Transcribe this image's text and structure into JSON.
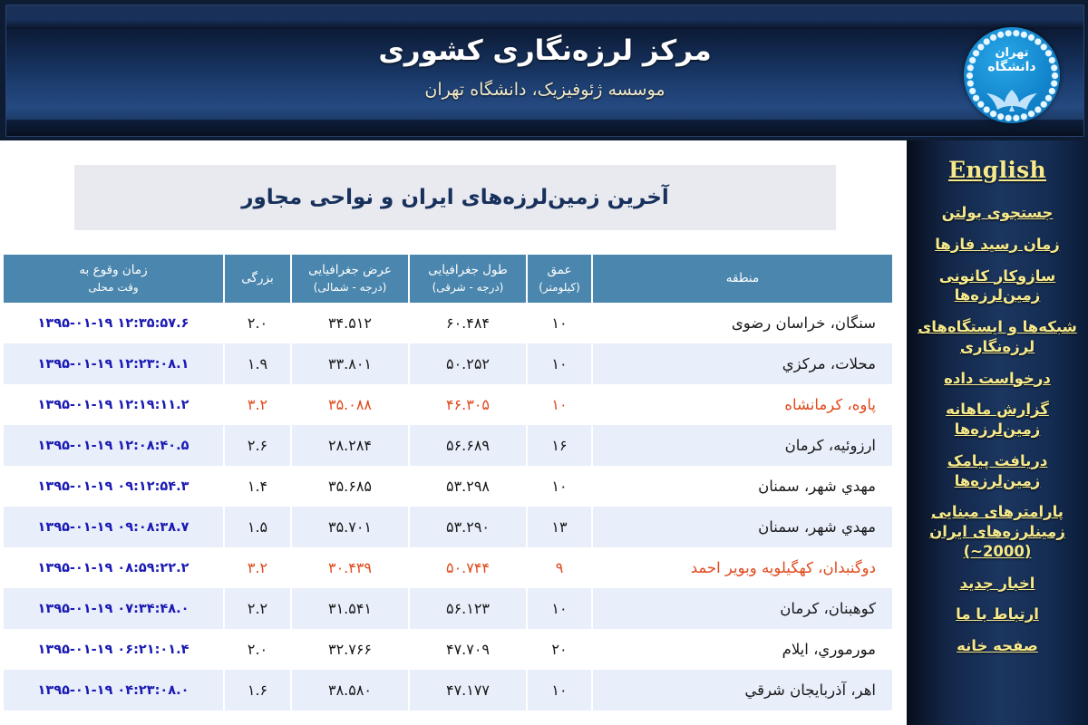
{
  "header": {
    "title": "مرکز لرزه‌نگاری کشوری",
    "subtitle": "موسسه ژئوفیزیک، دانشگاه تهران",
    "logo_line1": "تهران",
    "logo_line2": "دانشگاه",
    "logo_name": "university-of-tehran-logo"
  },
  "sidebar": {
    "english_label": "English",
    "items": [
      {
        "label": "جستجوی بولتن"
      },
      {
        "label": "زمان رسید فازها"
      },
      {
        "label": "سازوکار کانونی زمین‌لرزه‌ها"
      },
      {
        "label": "شبکه‌ها و ایستگاه‌های لرزه‌نگاری"
      },
      {
        "label": "درخواست داده"
      },
      {
        "label": "گزارش ماهانه زمین‌لرزه‌ها"
      },
      {
        "label": "دریافت پیامک زمین‌لرزه‌ها"
      },
      {
        "label": "پارامترهای مبنایی زمینلرزه‌های ایران (2000~)"
      },
      {
        "label": "اخبار جدید"
      },
      {
        "label": "ارتباط با ما"
      },
      {
        "label": "صفحه خانه"
      }
    ]
  },
  "main": {
    "page_title": "آخرین زمین‌لرزه‌های ایران و نواحی مجاور",
    "table": {
      "columns": [
        {
          "key": "region",
          "label": "منطقه",
          "sub": ""
        },
        {
          "key": "depth",
          "label": "عمق",
          "sub": "(کیلومتر)"
        },
        {
          "key": "longitude",
          "label": "طول جغرافیایی",
          "sub": "(درجه - شرقی)"
        },
        {
          "key": "latitude",
          "label": "عرض جغرافیایی",
          "sub": "(درجه - شمالی)"
        },
        {
          "key": "magnitude",
          "label": "بزرگی",
          "sub": ""
        },
        {
          "key": "time",
          "label": "زمان وقوع به",
          "sub": "وقت محلی"
        }
      ],
      "rows": [
        {
          "region": "سنگان، خراسان رضوی",
          "depth": "۱۰",
          "longitude": "۶۰.۴۸۴",
          "latitude": "۳۴.۵۱۲",
          "magnitude": "۲.۰",
          "time": "۱۳۹۵-۰۱-۱۹ ۱۲:۳۵:۵۷.۶",
          "alert": false
        },
        {
          "region": "محلات، مرکزي",
          "depth": "۱۰",
          "longitude": "۵۰.۲۵۲",
          "latitude": "۳۳.۸۰۱",
          "magnitude": "۱.۹",
          "time": "۱۳۹۵-۰۱-۱۹ ۱۲:۲۳:۰۸.۱",
          "alert": false
        },
        {
          "region": "پاوه، کرمانشاه",
          "depth": "۱۰",
          "longitude": "۴۶.۳۰۵",
          "latitude": "۳۵.۰۸۸",
          "magnitude": "۳.۲",
          "time": "۱۳۹۵-۰۱-۱۹ ۱۲:۱۹:۱۱.۲",
          "alert": true
        },
        {
          "region": "ارزوئیه، کرمان",
          "depth": "۱۶",
          "longitude": "۵۶.۶۸۹",
          "latitude": "۲۸.۲۸۴",
          "magnitude": "۲.۶",
          "time": "۱۳۹۵-۰۱-۱۹ ۱۲:۰۸:۴۰.۵",
          "alert": false
        },
        {
          "region": "مهدي شهر، سمنان",
          "depth": "۱۰",
          "longitude": "۵۳.۲۹۸",
          "latitude": "۳۵.۶۸۵",
          "magnitude": "۱.۴",
          "time": "۱۳۹۵-۰۱-۱۹ ۰۹:۱۲:۵۴.۳",
          "alert": false
        },
        {
          "region": "مهدي شهر، سمنان",
          "depth": "۱۳",
          "longitude": "۵۳.۲۹۰",
          "latitude": "۳۵.۷۰۱",
          "magnitude": "۱.۵",
          "time": "۱۳۹۵-۰۱-۱۹ ۰۹:۰۸:۳۸.۷",
          "alert": false
        },
        {
          "region": "دوگنبدان، کهگیلویه وبویر احمد",
          "depth": "۹",
          "longitude": "۵۰.۷۴۴",
          "latitude": "۳۰.۴۳۹",
          "magnitude": "۳.۲",
          "time": "۱۳۹۵-۰۱-۱۹ ۰۸:۵۹:۲۲.۲",
          "alert": true
        },
        {
          "region": "کوهبنان، کرمان",
          "depth": "۱۰",
          "longitude": "۵۶.۱۲۳",
          "latitude": "۳۱.۵۴۱",
          "magnitude": "۲.۲",
          "time": "۱۳۹۵-۰۱-۱۹ ۰۷:۳۴:۴۸.۰",
          "alert": false
        },
        {
          "region": "مورموري، ایلام",
          "depth": "۲۰",
          "longitude": "۴۷.۷۰۹",
          "latitude": "۳۲.۷۶۶",
          "magnitude": "۲.۰",
          "time": "۱۳۹۵-۰۱-۱۹ ۰۶:۲۱:۰۱.۴",
          "alert": false
        },
        {
          "region": "اهر، آذربایجان شرقي",
          "depth": "۱۰",
          "longitude": "۴۷.۱۷۷",
          "latitude": "۳۸.۵۸۰",
          "magnitude": "۱.۶",
          "time": "۱۳۹۵-۰۱-۱۹ ۰۴:۲۳:۰۸.۰",
          "alert": false
        }
      ]
    }
  },
  "colors": {
    "header_band": "#4a86ad",
    "row_alt": "#e8eefa",
    "title_band": "#e8eaef",
    "alert_text": "#e0491c",
    "time_text": "#1a1ab4",
    "sidebar_link": "#f6e98c",
    "banner_navy": "#15305a"
  }
}
